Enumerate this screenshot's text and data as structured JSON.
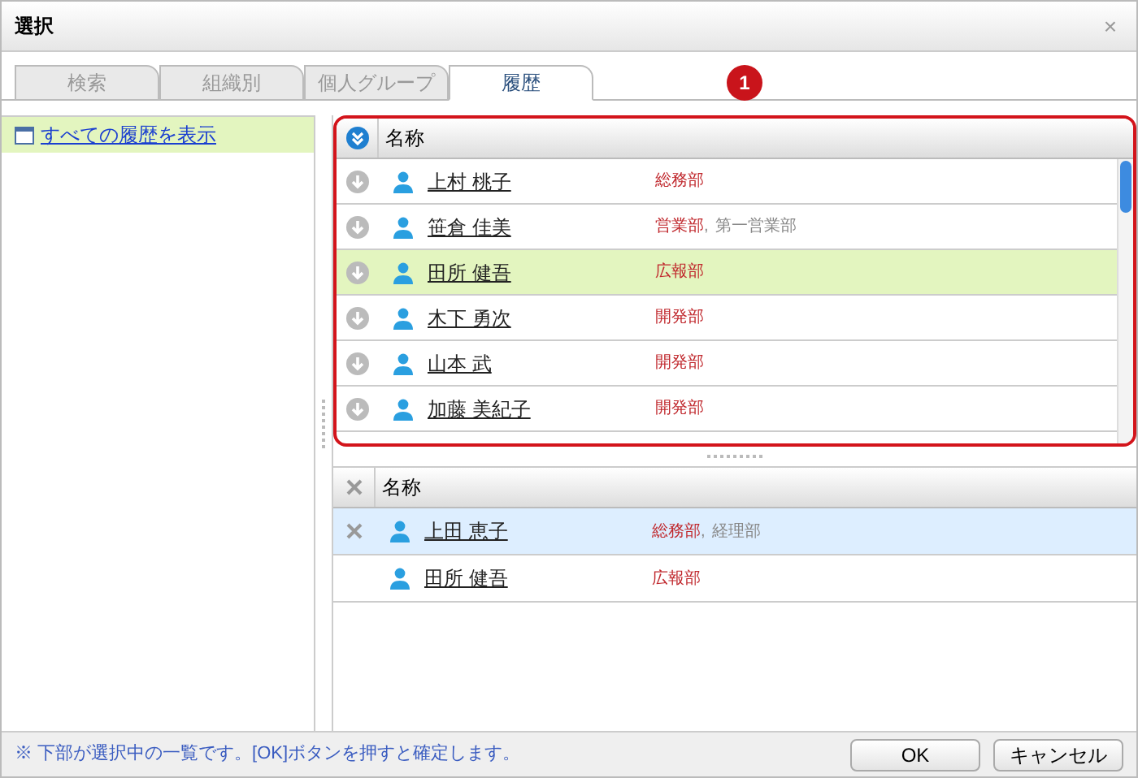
{
  "window": {
    "title": "選択",
    "close": "×"
  },
  "tabs": [
    {
      "label": "検索",
      "selected": false
    },
    {
      "label": "組織別",
      "selected": false
    },
    {
      "label": "個人グループ",
      "selected": false
    },
    {
      "label": "履歴",
      "selected": true
    }
  ],
  "sidebar": {
    "items": [
      {
        "label": "すべての履歴を表示",
        "selected": true
      }
    ]
  },
  "callout": {
    "label": "1"
  },
  "candidates": {
    "column": "名称",
    "rows": [
      {
        "name": "上村 桃子",
        "departments": [
          {
            "label": "総務部",
            "primary": true
          }
        ],
        "selected": false
      },
      {
        "name": "笹倉 佳美",
        "departments": [
          {
            "label": "営業部",
            "primary": true
          },
          {
            "separator": ",",
            "label": "第一営業部",
            "primary": false
          }
        ],
        "selected": false
      },
      {
        "name": "田所 健吾",
        "departments": [
          {
            "label": "広報部",
            "primary": true
          }
        ],
        "selected": true
      },
      {
        "name": "木下 勇次",
        "departments": [
          {
            "label": "開発部",
            "primary": true
          }
        ],
        "selected": false
      },
      {
        "name": "山本 武",
        "departments": [
          {
            "label": "開発部",
            "primary": true
          }
        ],
        "selected": false
      },
      {
        "name": "加藤 美紀子",
        "departments": [
          {
            "label": "開発部",
            "primary": true
          }
        ],
        "selected": false
      }
    ]
  },
  "chosen": {
    "column": "名称",
    "rows": [
      {
        "name": "上田 恵子",
        "departments": [
          {
            "label": "総務部",
            "primary": true
          },
          {
            "separator": ",",
            "label": "経理部",
            "primary": false
          }
        ],
        "selected": true
      },
      {
        "name": "田所 健吾",
        "departments": [
          {
            "label": "広報部",
            "primary": true
          }
        ],
        "selected": false
      }
    ]
  },
  "status_bar": {
    "note": "※ 下部が選択中の一覧です。[OK]ボタンを押すと確定します。"
  },
  "buttons": [
    "OK",
    "キャンセル"
  ]
}
